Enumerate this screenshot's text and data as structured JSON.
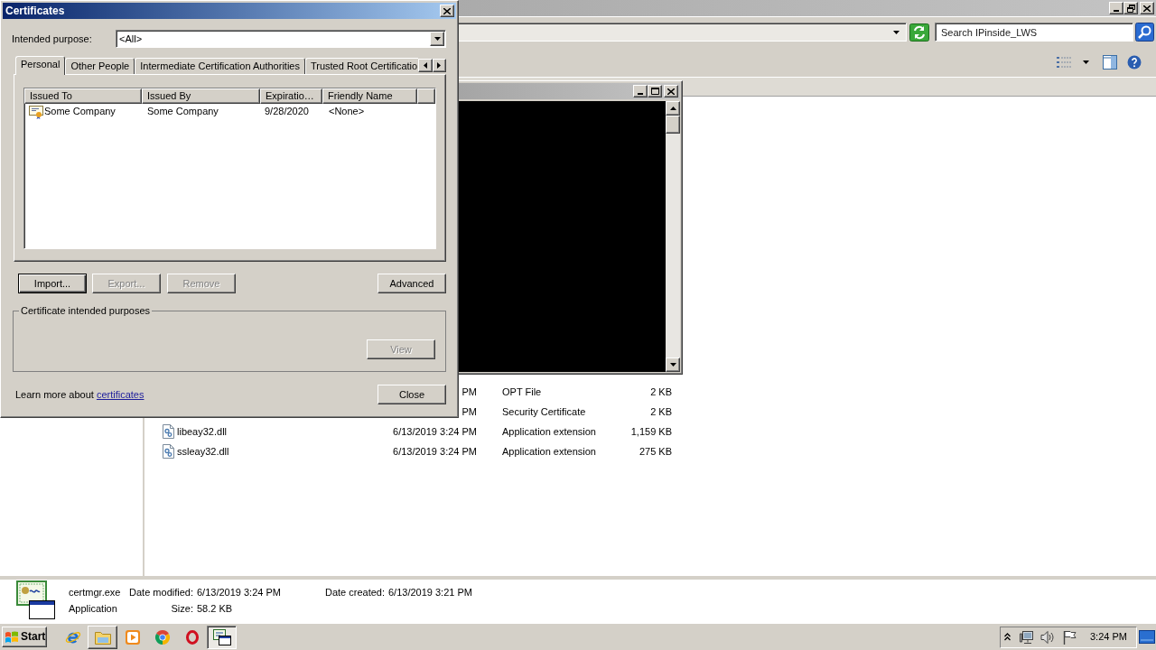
{
  "explorer": {
    "search": {
      "placeholder": "Search IPinside_LWS"
    },
    "files": [
      {
        "date": "PM",
        "type": "OPT File",
        "size": "2 KB",
        "selected": false
      },
      {
        "date": "PM",
        "type": "Security Certificate",
        "size": "2 KB",
        "selected": false
      },
      {
        "name": "libeay32.dll",
        "date": "6/13/2019 3:24 PM",
        "type": "Application extension",
        "size": "1,159 KB",
        "selected": false
      },
      {
        "name": "ssleay32.dll",
        "date": "6/13/2019 3:24 PM",
        "type": "Application extension",
        "size": "275 KB",
        "selected": false
      }
    ],
    "details": {
      "name": "certmgr.exe",
      "type": "Application",
      "fields": [
        {
          "label": "Date modified:",
          "value": "6/13/2019 3:24 PM"
        },
        {
          "label": "Date created:",
          "value": "6/13/2019 3:21 PM"
        },
        {
          "label": "Size:",
          "value": "58.2 KB"
        }
      ]
    }
  },
  "dialog": {
    "title": "Certificates",
    "purpose": {
      "label": "Intended purpose:",
      "value": "<All>"
    },
    "tabs": [
      {
        "label": "Personal",
        "selected": true
      },
      {
        "label": "Other People",
        "selected": false
      },
      {
        "label": "Intermediate Certification Authorities",
        "selected": false
      },
      {
        "label": "Trusted Root Certificatio",
        "selected": false
      }
    ],
    "columns": [
      "Issued To",
      "Issued By",
      "Expiratio…",
      "Friendly Name"
    ],
    "rows": [
      {
        "issued_to": "Some Company",
        "issued_by": "Some Company",
        "expiration": "9/28/2020",
        "friendly_name": "<None>",
        "selected": false
      }
    ],
    "buttons": [
      {
        "label": "Import...",
        "disabled": false,
        "default": true
      },
      {
        "label": "Export...",
        "disabled": true,
        "default": false
      },
      {
        "label": "Remove",
        "disabled": true,
        "default": false
      },
      {
        "label": "Advanced",
        "disabled": false,
        "default": false
      }
    ],
    "purposes_group": {
      "title": "Certificate intended purposes",
      "button": {
        "label": "View",
        "disabled": true
      }
    },
    "learn_more": {
      "text": "Learn more about",
      "link": "certificates"
    },
    "close_button": {
      "label": "Close"
    }
  },
  "taskbar": {
    "start": "Start",
    "apps": [
      {
        "kind": "e_browser",
        "running": false,
        "selected": false
      },
      {
        "kind": "folder",
        "running": true,
        "selected": false
      },
      {
        "kind": "media",
        "running": false,
        "selected": false
      },
      {
        "kind": "circle_browser",
        "running": false,
        "selected": false
      },
      {
        "kind": "ring_browser",
        "running": false,
        "selected": false
      },
      {
        "kind": "certmgr",
        "running": true,
        "selected": true
      }
    ],
    "clock": "3:24 PM"
  }
}
